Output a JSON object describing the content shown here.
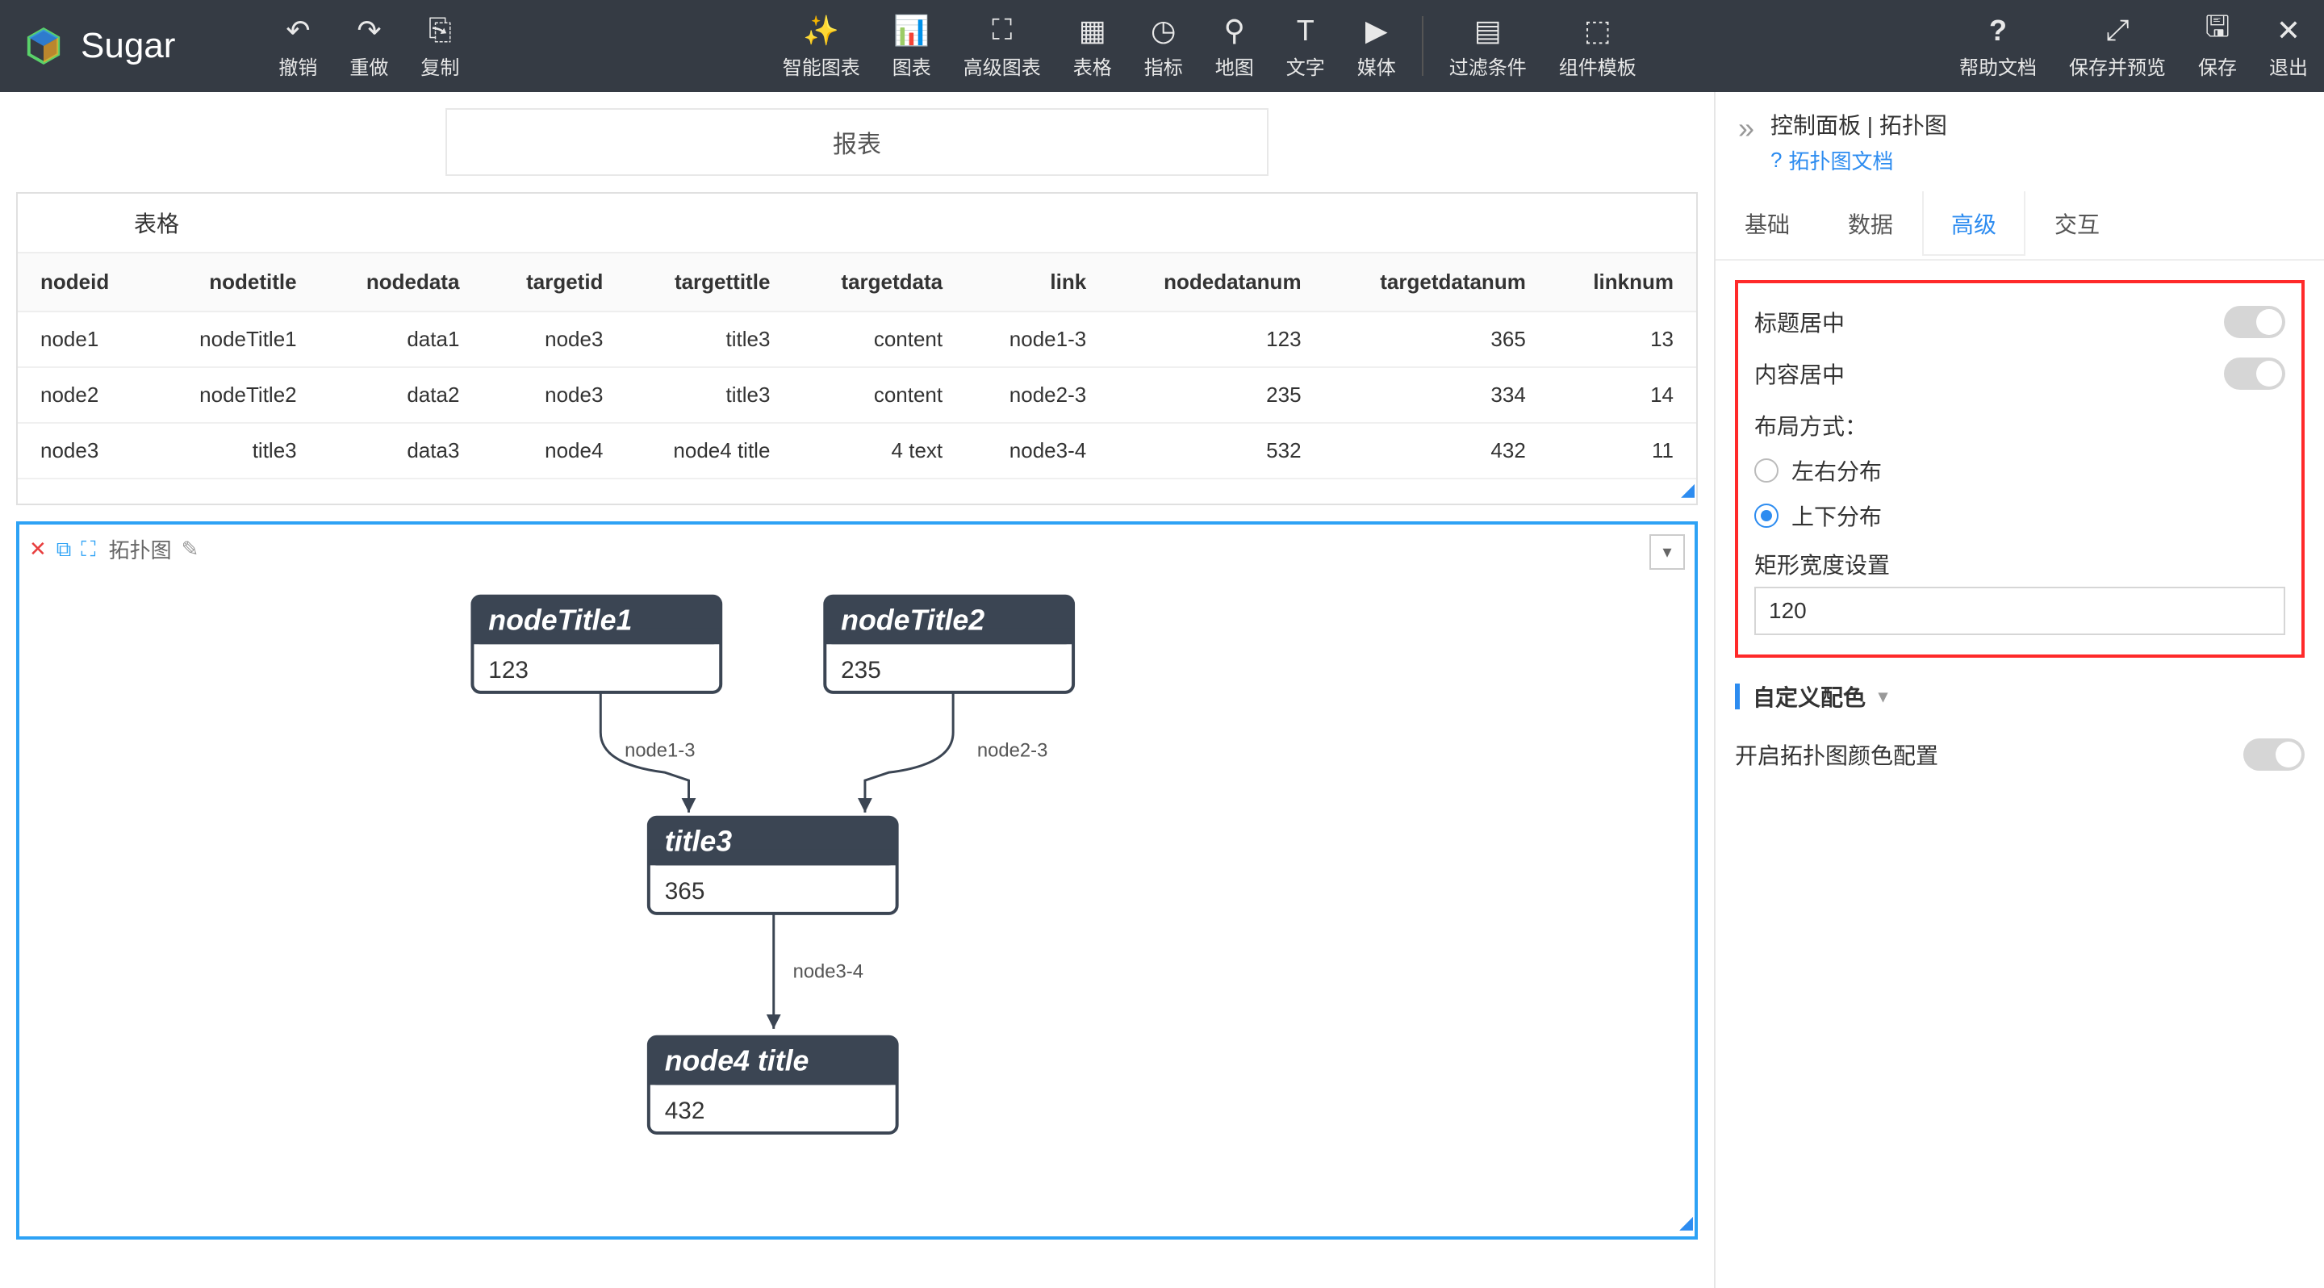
{
  "brand": "Sugar",
  "toolbar": {
    "undo": "撤销",
    "redo": "重做",
    "copy": "复制",
    "smartChart": "智能图表",
    "chart": "图表",
    "advChart": "高级图表",
    "table": "表格",
    "indicator": "指标",
    "map": "地图",
    "text": "文字",
    "media": "媒体",
    "filter": "过滤条件",
    "componentTpl": "组件模板",
    "helpDoc": "帮助文档",
    "savePreview": "保存并预览",
    "save": "保存",
    "exit": "退出"
  },
  "canvas": {
    "title": "报表"
  },
  "tableCard": {
    "title": "表格",
    "columns": [
      "nodeid",
      "nodetitle",
      "nodedata",
      "targetid",
      "targettitle",
      "targetdata",
      "link",
      "nodedatanum",
      "targetdatanum",
      "linknum"
    ],
    "rows": [
      [
        "node1",
        "nodeTitle1",
        "data1",
        "node3",
        "title3",
        "content",
        "node1-3",
        "123",
        "365",
        "13"
      ],
      [
        "node2",
        "nodeTitle2",
        "data2",
        "node3",
        "title3",
        "content",
        "node2-3",
        "235",
        "334",
        "14"
      ],
      [
        "node3",
        "title3",
        "data3",
        "node4",
        "node4 title",
        "4 text",
        "node3-4",
        "532",
        "432",
        "11"
      ]
    ]
  },
  "topo": {
    "name": "拓扑图",
    "nodes": {
      "n1": {
        "title": "nodeTitle1",
        "value": "123"
      },
      "n2": {
        "title": "nodeTitle2",
        "value": "235"
      },
      "n3": {
        "title": "title3",
        "value": "365"
      },
      "n4": {
        "title": "node4 title",
        "value": "432"
      }
    },
    "edges": {
      "e1": "node1-3",
      "e2": "node2-3",
      "e3": "node3-4"
    }
  },
  "panel": {
    "title": "控制面板 | 拓扑图",
    "docLink": "拓扑图文档",
    "tabs": {
      "basic": "基础",
      "data": "数据",
      "adv": "高级",
      "interact": "交互"
    },
    "titleCenter": "标题居中",
    "contentCenter": "内容居中",
    "layoutLabel": "布局方式：",
    "layoutLR": "左右分布",
    "layoutTB": "上下分布",
    "rectWidthLabel": "矩形宽度设置",
    "rectWidthValue": "120",
    "customColor": "自定义配色",
    "enableTopoColor": "开启拓扑图颜色配置"
  }
}
